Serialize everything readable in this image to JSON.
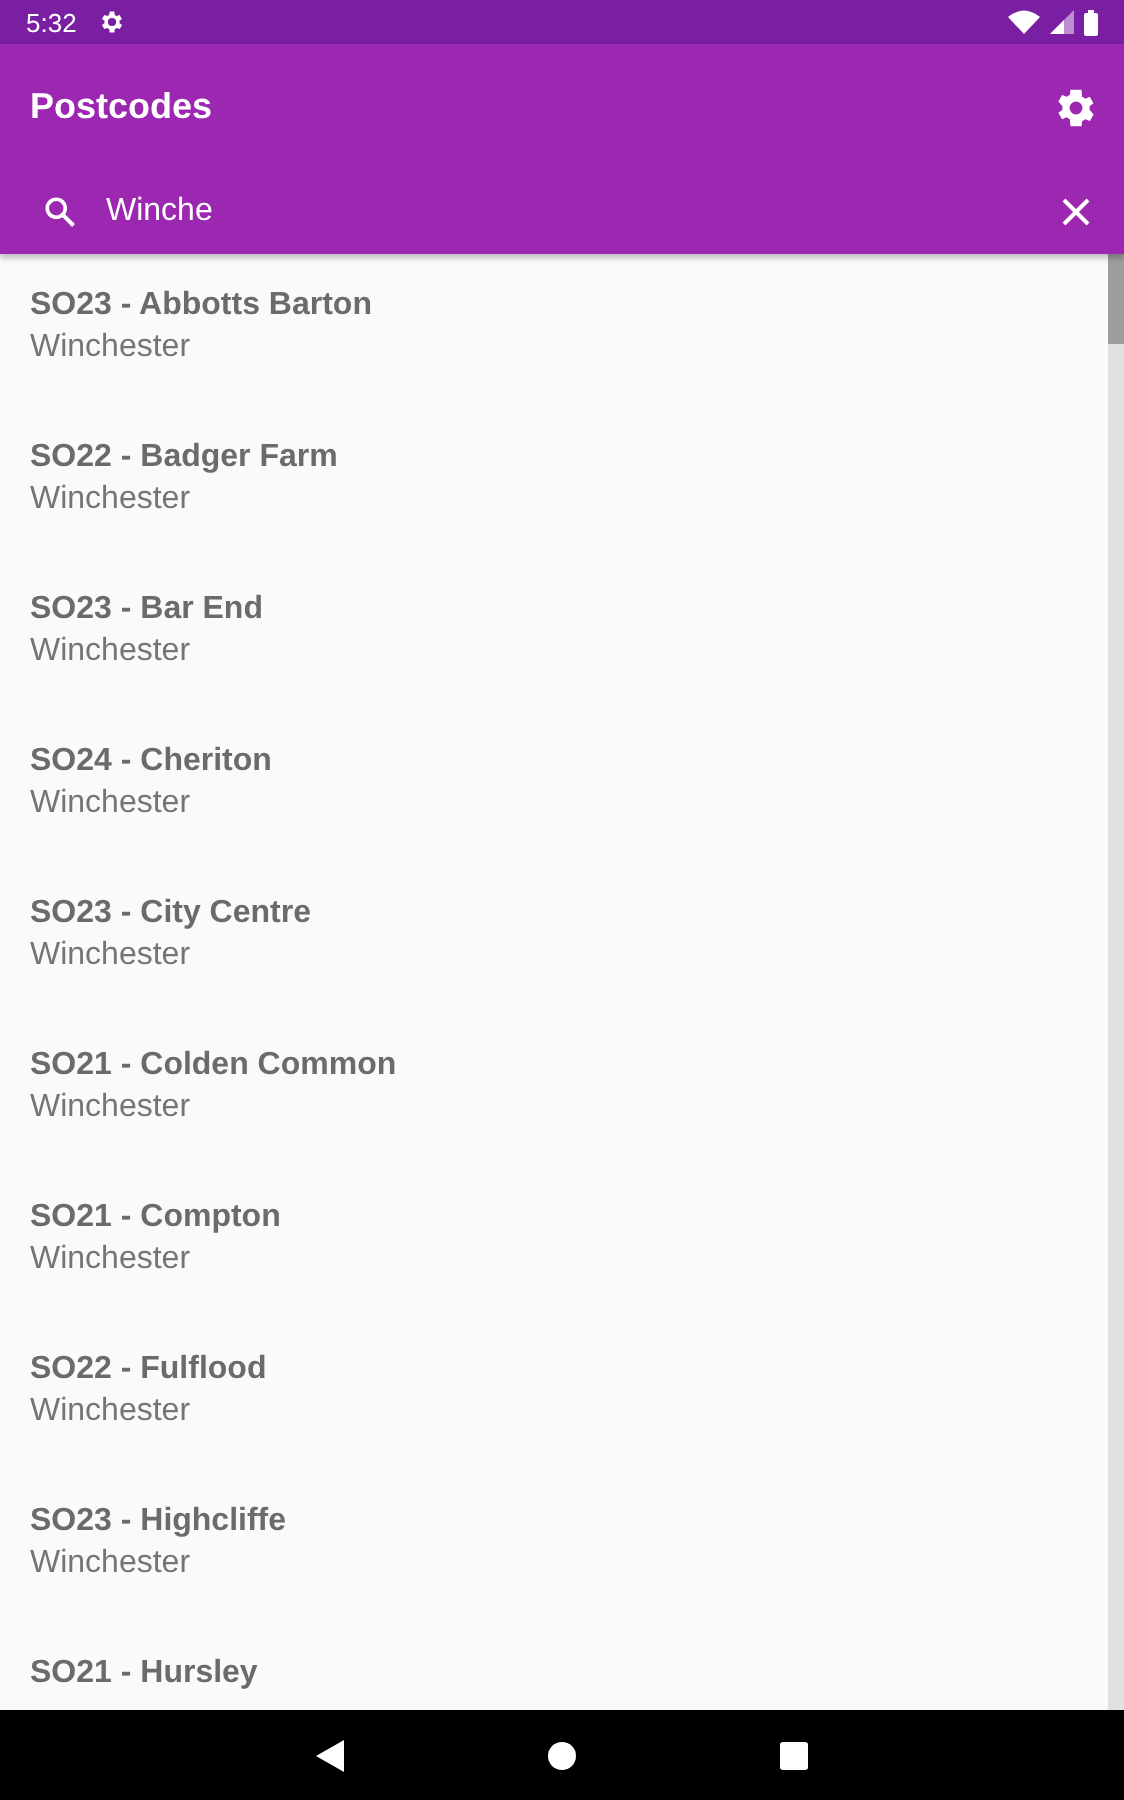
{
  "status_bar": {
    "time": "5:32"
  },
  "app_bar": {
    "title": "Postcodes"
  },
  "search": {
    "value": "Winche"
  },
  "results": [
    {
      "title": "SO23 - Abbotts Barton",
      "subtitle": "Winchester"
    },
    {
      "title": "SO22 - Badger Farm",
      "subtitle": "Winchester"
    },
    {
      "title": "SO23 - Bar End",
      "subtitle": "Winchester"
    },
    {
      "title": "SO24 - Cheriton",
      "subtitle": "Winchester"
    },
    {
      "title": "SO23 - City Centre",
      "subtitle": "Winchester"
    },
    {
      "title": "SO21 - Colden Common",
      "subtitle": "Winchester"
    },
    {
      "title": "SO21 - Compton",
      "subtitle": "Winchester"
    },
    {
      "title": "SO22 - Fulflood",
      "subtitle": "Winchester"
    },
    {
      "title": "SO23 - Highcliffe",
      "subtitle": "Winchester"
    },
    {
      "title": "SO21 - Hursley"
    }
  ]
}
